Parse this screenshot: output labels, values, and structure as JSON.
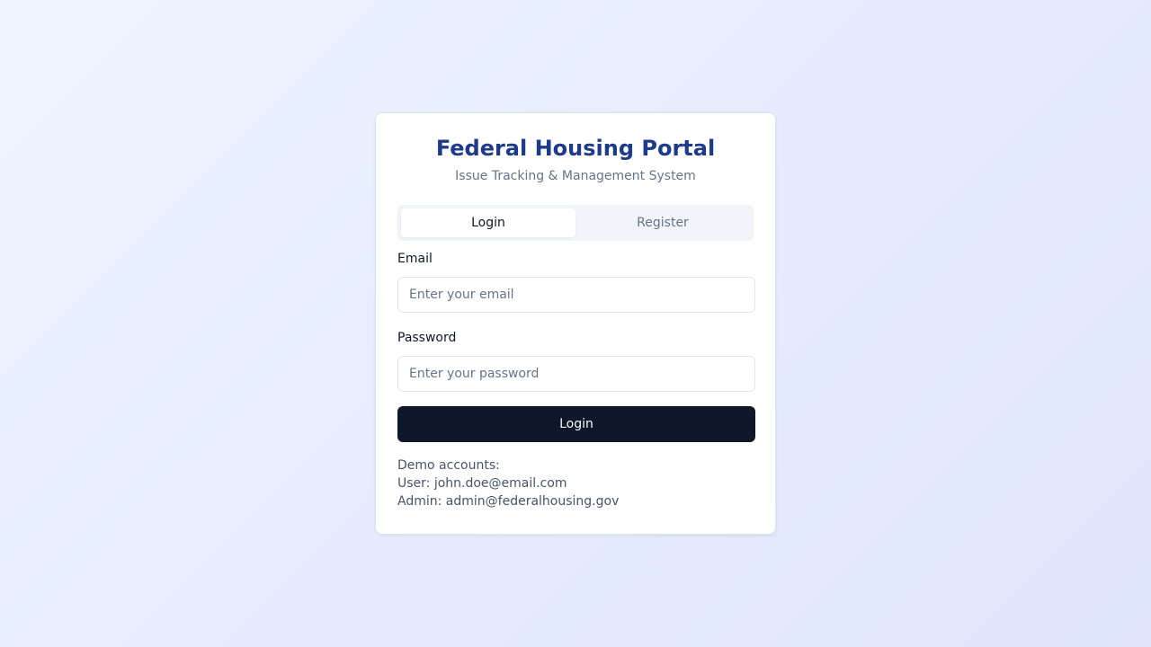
{
  "header": {
    "title": "Federal Housing Portal",
    "subtitle": "Issue Tracking & Management System"
  },
  "tabs": [
    {
      "label": "Login",
      "active": true
    },
    {
      "label": "Register",
      "active": false
    }
  ],
  "form": {
    "email": {
      "label": "Email",
      "placeholder": "Enter your email",
      "value": ""
    },
    "password": {
      "label": "Password",
      "placeholder": "Enter your password",
      "value": ""
    },
    "submit_label": "Login"
  },
  "demo": {
    "heading": "Demo accounts:",
    "user_line": "User: john.doe@email.com",
    "admin_line": "Admin: admin@federalhousing.gov"
  },
  "colors": {
    "title": "#1e3a8a",
    "primary_button": "#0f172a",
    "muted_text": "#64748b"
  }
}
